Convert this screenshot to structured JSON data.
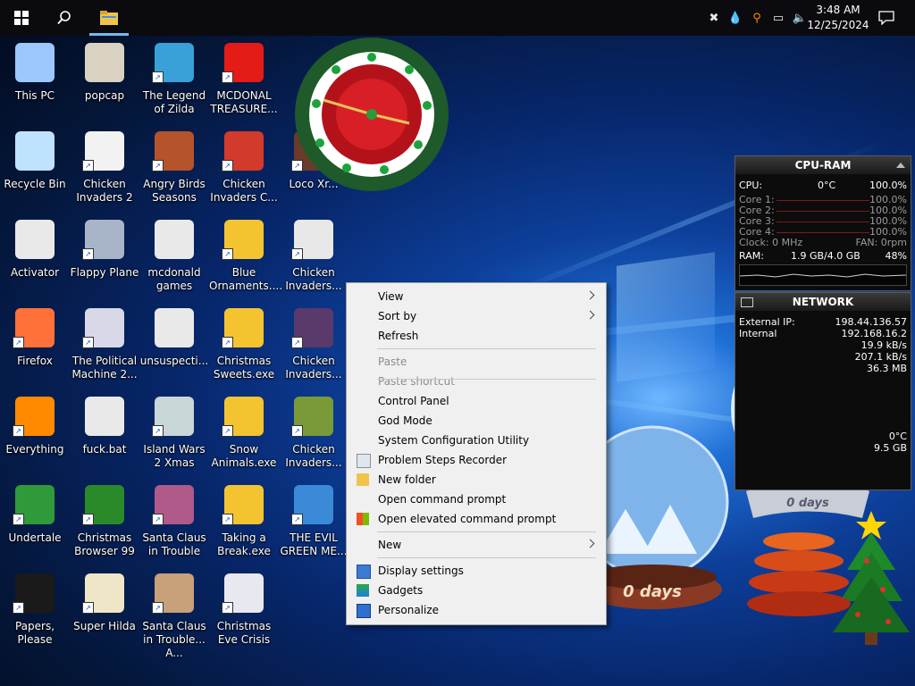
{
  "taskbar": {
    "time": "3:48 AM",
    "date": "12/25/2024",
    "start_icon": "windows-logo-icon",
    "search_icon": "search-icon",
    "explorer_icon": "folder-icon"
  },
  "desktop_icons": [
    {
      "label": "This PC",
      "icon": "computer-icon",
      "color": "#9cc8ff",
      "shortcut": false
    },
    {
      "label": "popcap",
      "icon": "folder-icon",
      "color": "#d9d2c3",
      "shortcut": false
    },
    {
      "label": "The Legend of Zilda",
      "icon": "game-icon",
      "color": "#3aa0d8",
      "shortcut": true
    },
    {
      "label": "MCDONAL TREASURE...",
      "icon": "game-icon",
      "color": "#e41b17",
      "shortcut": true
    },
    {
      "label": "Recycle Bin",
      "icon": "recycle-bin-icon",
      "color": "#bfe3ff",
      "shortcut": false
    },
    {
      "label": "Chicken Invaders 2",
      "icon": "chicken-icon",
      "color": "#f2f2f2",
      "shortcut": true
    },
    {
      "label": "Angry Birds Seasons",
      "icon": "game-icon",
      "color": "#b5532d",
      "shortcut": true
    },
    {
      "label": "Chicken Invaders C...",
      "icon": "game-icon",
      "color": "#d23a2b",
      "shortcut": true
    },
    {
      "label": "Loco Xr...",
      "icon": "game-icon",
      "color": "#6a3a2a",
      "shortcut": true
    },
    {
      "label": "Activator",
      "icon": "file-icon",
      "color": "#e9e9e9",
      "shortcut": false
    },
    {
      "label": "Flappy Plane",
      "icon": "game-icon",
      "color": "#a8b4c8",
      "shortcut": true
    },
    {
      "label": "mcdonald games",
      "icon": "folder-icon",
      "color": "#e9e9e9",
      "shortcut": false
    },
    {
      "label": "Blue Ornaments....",
      "icon": "exe-icon",
      "color": "#f4c430",
      "shortcut": true
    },
    {
      "label": "Chicken Invaders...",
      "icon": "game-icon",
      "color": "#e8e8e8",
      "shortcut": true
    },
    {
      "label": "Firefox",
      "icon": "firefox-icon",
      "color": "#ff7139",
      "shortcut": true
    },
    {
      "label": "The Political Machine 2...",
      "icon": "game-icon",
      "color": "#d8d8e8",
      "shortcut": true
    },
    {
      "label": "unsuspecti...",
      "icon": "folder-icon",
      "color": "#e9e9e9",
      "shortcut": false
    },
    {
      "label": "Christmas Sweets.exe",
      "icon": "exe-icon",
      "color": "#f4c430",
      "shortcut": true
    },
    {
      "label": "Chicken Invaders...",
      "icon": "game-icon",
      "color": "#5a3a6a",
      "shortcut": true
    },
    {
      "label": "Everything",
      "icon": "magnifier-icon",
      "color": "#ff8a00",
      "shortcut": true
    },
    {
      "label": "fuck.bat",
      "icon": "gear-file-icon",
      "color": "#e9e9e9",
      "shortcut": false
    },
    {
      "label": "Island Wars 2 Xmas",
      "icon": "game-icon",
      "color": "#c9d6d8",
      "shortcut": true
    },
    {
      "label": "Snow Animals.exe",
      "icon": "exe-icon",
      "color": "#f4c430",
      "shortcut": true
    },
    {
      "label": "Chicken Invaders...",
      "icon": "game-icon",
      "color": "#7a9a3a",
      "shortcut": true
    },
    {
      "label": "Undertale",
      "icon": "game-icon",
      "color": "#2f9a3a",
      "shortcut": true
    },
    {
      "label": "Christmas Browser 99",
      "icon": "tree-icon",
      "color": "#2a8a2a",
      "shortcut": true
    },
    {
      "label": "Santa Claus in Trouble",
      "icon": "game-icon",
      "color": "#b05a8a",
      "shortcut": true
    },
    {
      "label": "Taking a Break.exe",
      "icon": "exe-icon",
      "color": "#f4c430",
      "shortcut": true
    },
    {
      "label": "THE EVIL GREEN ME...",
      "icon": "messenger-icon",
      "color": "#3a8ad8",
      "shortcut": true
    },
    {
      "label": "Papers, Please",
      "icon": "game-icon",
      "color": "#1a1a1a",
      "shortcut": true
    },
    {
      "label": "Super Hilda",
      "icon": "game-icon",
      "color": "#efe6c8",
      "shortcut": true
    },
    {
      "label": "Santa Claus in Trouble... A...",
      "icon": "game-icon",
      "color": "#c8a07a",
      "shortcut": true
    },
    {
      "label": "Christmas Eve Crisis",
      "icon": "game-icon",
      "color": "#e8e8f0",
      "shortcut": true
    }
  ],
  "context_menu": {
    "items": [
      {
        "label": "View",
        "submenu": true,
        "disabled": false,
        "icon": ""
      },
      {
        "label": "Sort by",
        "submenu": true,
        "disabled": false,
        "icon": ""
      },
      {
        "label": "Refresh",
        "submenu": false,
        "disabled": false,
        "icon": ""
      },
      {
        "label": "Paste",
        "submenu": false,
        "disabled": true,
        "icon": ""
      },
      {
        "label": "Paste shortcut",
        "submenu": false,
        "disabled": true,
        "icon": ""
      },
      {
        "label": "Control Panel",
        "submenu": false,
        "disabled": false,
        "icon": ""
      },
      {
        "label": "God Mode",
        "submenu": false,
        "disabled": false,
        "icon": ""
      },
      {
        "label": "System Configuration Utility",
        "submenu": false,
        "disabled": false,
        "icon": ""
      },
      {
        "label": "Problem Steps Recorder",
        "submenu": false,
        "disabled": false,
        "icon": "recorder-icon"
      },
      {
        "label": "New folder",
        "submenu": false,
        "disabled": false,
        "icon": "folder-icon"
      },
      {
        "label": "Open command prompt",
        "submenu": false,
        "disabled": false,
        "icon": ""
      },
      {
        "label": "Open elevated command prompt",
        "submenu": false,
        "disabled": false,
        "icon": "windows-logo-icon"
      },
      {
        "label": "New",
        "submenu": true,
        "disabled": false,
        "icon": ""
      },
      {
        "label": "Display settings",
        "submenu": false,
        "disabled": false,
        "icon": "display-icon"
      },
      {
        "label": "Gadgets",
        "submenu": false,
        "disabled": false,
        "icon": "gadgets-icon"
      },
      {
        "label": "Personalize",
        "submenu": false,
        "disabled": false,
        "icon": "personalize-icon"
      }
    ]
  },
  "cpu_gadget": {
    "title": "CPU-RAM",
    "cpu_label": "CPU:",
    "cpu_temp": "0°C",
    "cpu_value": "100.0%",
    "cores": [
      {
        "label": "Core 1:",
        "value": "100.0%"
      },
      {
        "label": "Core 2:",
        "value": "100.0%"
      },
      {
        "label": "Core 3:",
        "value": "100.0%"
      },
      {
        "label": "Core 4:",
        "value": "100.0%"
      }
    ],
    "clock": "Clock: 0 MHz",
    "fan": "FAN: 0rpm",
    "ram_label": "RAM:",
    "ram_value": "1.9 GB/4.0 GB",
    "ram_percent": "48%"
  },
  "network_gadget": {
    "title": "NETWORK",
    "rows": [
      {
        "label": "External IP:",
        "value": "198.44.136.57"
      },
      {
        "label": "Internal",
        "value": "192.168.16.2"
      },
      {
        "label": "",
        "value": "19.9 kB/s"
      },
      {
        "label": "",
        "value": "207.1 kB/s"
      },
      {
        "label": "",
        "value": "36.3 MB"
      }
    ],
    "extra_temp": "0°C",
    "extra_size": "9.5 GB"
  },
  "snow_globe_counter": "0 days",
  "snow_globe_counter_2": "0 days"
}
